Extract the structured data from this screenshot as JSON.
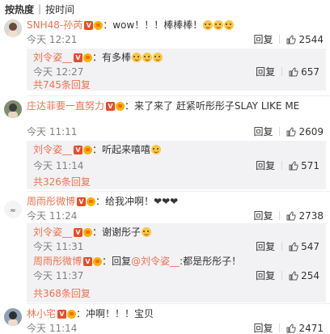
{
  "sort": {
    "hot": "按热度",
    "time": "按时间"
  },
  "comments": [
    {
      "user": "SNH48-孙芮",
      "text": "：wow！！！棒棒棒！",
      "time": "今天 12:21",
      "reply": "回复",
      "likes": "2544",
      "avatar_color": "#c8c8c8",
      "replies": [
        {
          "user": "刘令姿__",
          "text": "：有多棒",
          "time": "今天 12:27",
          "reply": "回复",
          "likes": "657"
        }
      ],
      "more": "共745条回复"
    },
    {
      "user": "庄达菲要一直努力",
      "text": "：来了来了 赶紧听彤彤子SLAY LIKE ME",
      "time": "今天 11:11",
      "reply": "回复",
      "likes": "2609",
      "avatar_color": "#7a8a6a",
      "replies": [
        {
          "user": "刘令姿__",
          "text": "：听起来嘻嘻",
          "time": "今天 11:14",
          "reply": "回复",
          "likes": "571"
        }
      ],
      "more": "共326条回复"
    },
    {
      "user": "周雨彤微博",
      "text": "：给我冲啊！❤❤❤",
      "time": "今天 11:24",
      "reply": "回复",
      "likes": "2738",
      "avatar_color": "#e8e8e8",
      "replies": [
        {
          "user": "刘令姿__",
          "text": "：谢谢彤子",
          "time": "今天 11:31",
          "reply": "回复",
          "likes": "547"
        },
        {
          "user": "周雨彤微博",
          "text_prefix": "：回复",
          "mention": "@刘令姿__",
          "text_suffix": ":都是彤彤子！",
          "time": "今天 11:37",
          "reply": "回复",
          "likes": "254"
        }
      ],
      "more": "共368条回复"
    },
    {
      "user": "林小宅",
      "text": "：冲啊！！！宝贝",
      "time": "今天 11:14",
      "reply": "回复",
      "likes": "2471",
      "avatar_color": "#9aa7b8",
      "replies": [],
      "more": ""
    }
  ],
  "colors": {
    "username": "#eb7350",
    "time": "#808080",
    "reply_bg": "#f2f2f5"
  }
}
